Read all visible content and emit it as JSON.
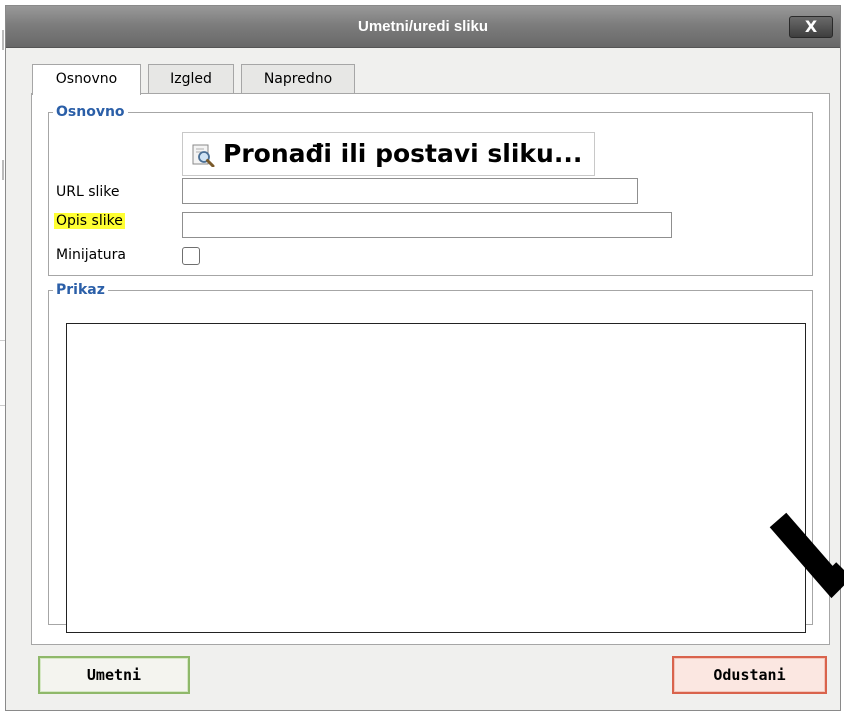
{
  "dialog": {
    "title": "Umetni/uredi sliku",
    "close_label": "X"
  },
  "tabs": [
    {
      "label": "Osnovno",
      "active": true
    },
    {
      "label": "Izgled",
      "active": false
    },
    {
      "label": "Napredno",
      "active": false
    }
  ],
  "basic": {
    "legend": "Osnovno",
    "find_button": "Pronađi ili postavi sliku...",
    "find_icon": "magnifier-icon",
    "url_label": "URL slike",
    "url_value": "",
    "desc_label": "Opis slike",
    "desc_value": "",
    "desc_highlight": "#ffff33",
    "thumb_label": "Minijatura",
    "thumb_checked": false
  },
  "preview": {
    "legend": "Prikaz"
  },
  "buttons": {
    "insert": "Umetni",
    "cancel": "Odustani"
  },
  "colors": {
    "legend": "#2b5fa8",
    "insert_border": "#8fb86a",
    "cancel_border": "#d9634c"
  }
}
